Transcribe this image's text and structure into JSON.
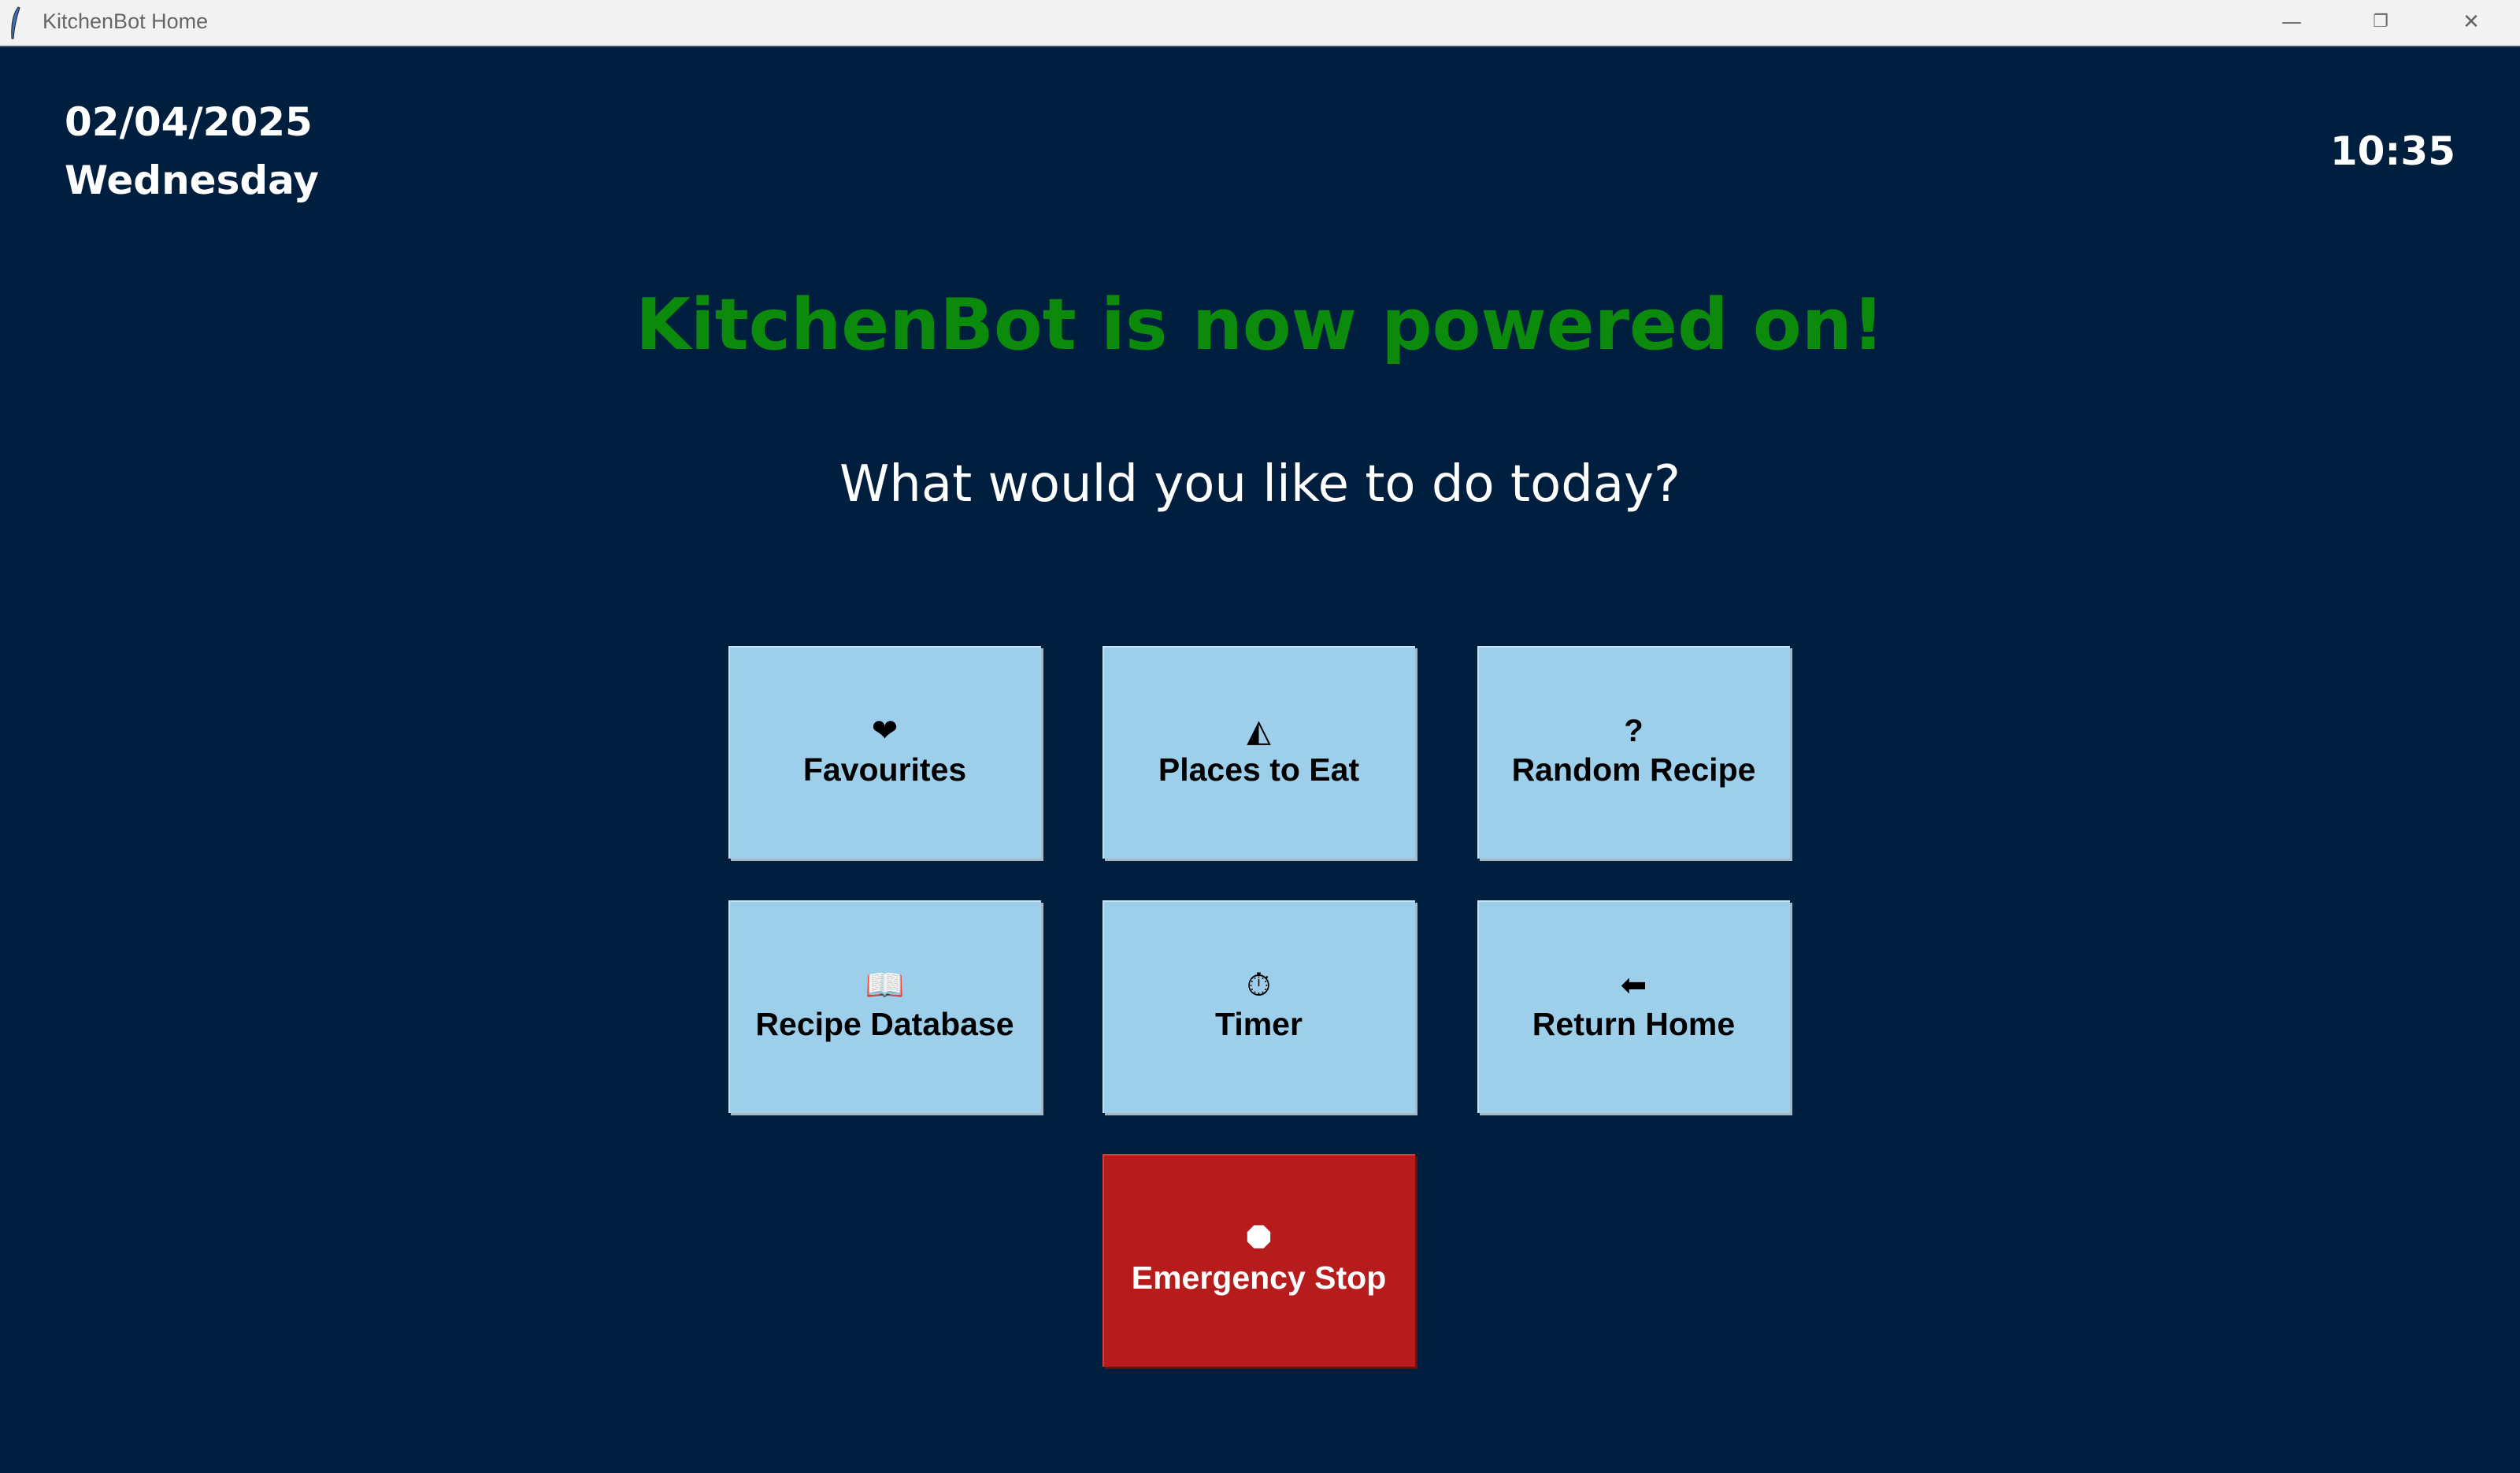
{
  "window": {
    "title": "KitchenBot Home",
    "controls": {
      "minimize": "—",
      "restore": "❐",
      "close": "✕"
    }
  },
  "header": {
    "date": "02/04/2025",
    "weekday": "Wednesday",
    "time": "10:35"
  },
  "main": {
    "headline": "KitchenBot is now powered on!",
    "prompt": "What would you like to do today?",
    "colors": {
      "background": "#001f3f",
      "headline": "#0b8a0b",
      "button": "#9dcfeb",
      "emergency": "#b61c1c"
    },
    "buttons": [
      {
        "label": "Favourites",
        "icon": "heart-icon",
        "glyph": "❤"
      },
      {
        "label": "Places to Eat",
        "icon": "pizza-icon",
        "glyph": "◭"
      },
      {
        "label": "Random Recipe",
        "icon": "question-icon",
        "glyph": "?"
      },
      {
        "label": "Recipe Database",
        "icon": "book-icon",
        "glyph": "📖"
      },
      {
        "label": "Timer",
        "icon": "stopwatch-icon",
        "glyph": "⏱"
      },
      {
        "label": "Return Home",
        "icon": "back-arrow-icon",
        "glyph": "⬅"
      },
      {
        "label": "Emergency Stop",
        "icon": "stop-sign-icon",
        "glyph": "⯃"
      }
    ]
  }
}
